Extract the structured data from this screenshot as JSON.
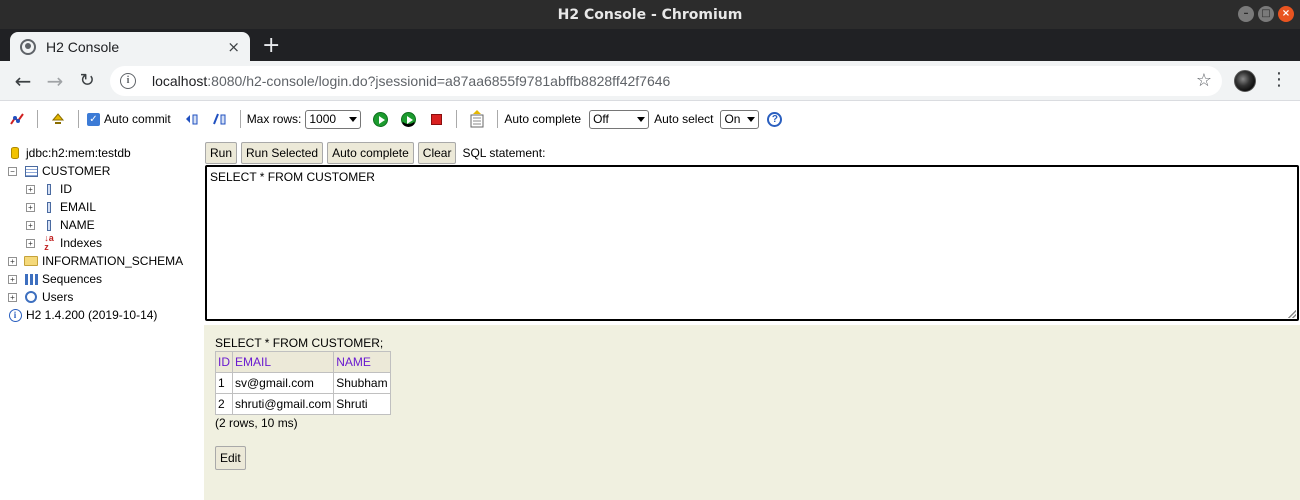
{
  "window": {
    "title": "H2 Console - Chromium"
  },
  "tab": {
    "title": "H2 Console",
    "close": "×",
    "new_tab": "+"
  },
  "address": {
    "host": "localhost",
    "rest": ":8080/h2-console/login.do?jsessionid=a87aa6855f9781abffb8828ff42f7646"
  },
  "h2_toolbar": {
    "auto_commit_label": "Auto commit",
    "auto_commit_checked": true,
    "max_rows_label": "Max rows:",
    "max_rows_value": "1000",
    "auto_complete_label": "Auto complete",
    "auto_complete_value": "Off",
    "auto_select_label": "Auto select",
    "auto_select_value": "On"
  },
  "tree": {
    "connection": "jdbc:h2:mem:testdb",
    "table": "CUSTOMER",
    "columns": [
      "ID",
      "EMAIL",
      "NAME"
    ],
    "indexes": "Indexes",
    "schema": "INFORMATION_SCHEMA",
    "sequences": "Sequences",
    "users": "Users",
    "version": "H2 1.4.200 (2019-10-14)"
  },
  "query_bar": {
    "run": "Run",
    "run_selected": "Run Selected",
    "auto_complete": "Auto complete",
    "clear": "Clear",
    "sql_label": "SQL statement:"
  },
  "editor": {
    "sql": "SELECT * FROM CUSTOMER"
  },
  "results": {
    "query": "SELECT * FROM CUSTOMER;",
    "headers": [
      "ID",
      "EMAIL",
      "NAME"
    ],
    "rows": [
      [
        "1",
        "sv@gmail.com",
        "Shubham"
      ],
      [
        "2",
        "shruti@gmail.com",
        "Shruti"
      ]
    ],
    "summary": "(2 rows, 10 ms)",
    "edit": "Edit"
  }
}
